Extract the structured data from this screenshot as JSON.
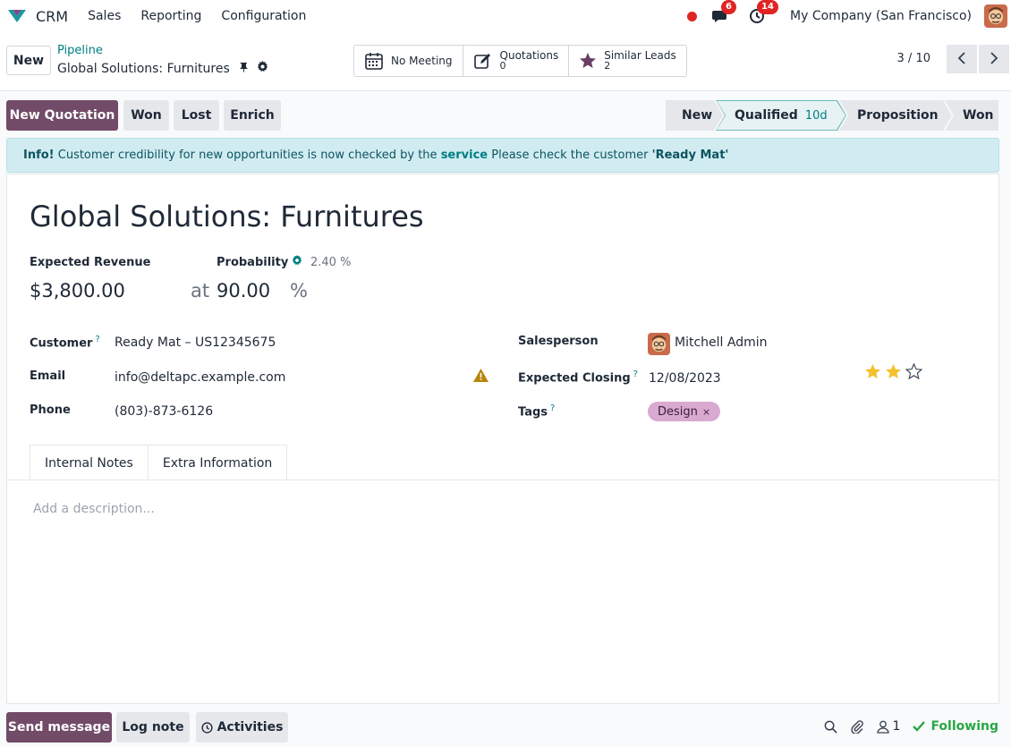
{
  "topbar": {
    "app_name": "CRM",
    "menu": [
      "Sales",
      "Reporting",
      "Configuration"
    ],
    "messages_count": "6",
    "activities_count": "14",
    "company": "My Company (San Francisco)",
    "brand_color": "#714b67",
    "badge_color": "#e02424",
    "rec_color": "#e02424"
  },
  "control": {
    "new_label": "New",
    "breadcrumb": "Pipeline",
    "record_title": "Global Solutions: Furnitures",
    "smart_buttons": [
      {
        "label": "No Meeting",
        "value": "",
        "icon": "calendar-icon"
      },
      {
        "label": "Quotations",
        "value": "0",
        "icon": "pen-square-icon"
      },
      {
        "label": "Similar Leads",
        "value": "2",
        "icon": "star-icon"
      }
    ],
    "pager": "3 / 10",
    "prev": "‹",
    "next": "›"
  },
  "actions": {
    "new_quotation": "New Quotation",
    "won": "Won",
    "lost": "Lost",
    "enrich": "Enrich"
  },
  "stages": [
    {
      "label": "New",
      "duration": ""
    },
    {
      "label": "Qualified",
      "duration": "10d"
    },
    {
      "label": "Proposition",
      "duration": ""
    },
    {
      "label": "Won",
      "duration": ""
    }
  ],
  "alert": {
    "prefix": "Info!",
    "text1": "Customer credibility for new opportunities is now checked by the",
    "link": "service",
    "text2": "Please check the customer",
    "customer": "'Ready Mat'"
  },
  "form": {
    "name": "Global Solutions: Furnitures",
    "expected_revenue_label": "Expected Revenue",
    "expected_revenue": "$3,800.00",
    "at": "at",
    "probability_label": "Probability",
    "probability_auto": "2.40 %",
    "probability": "90.00",
    "percent": "%",
    "customer_label": "Customer",
    "customer": "Ready Mat – US12345675",
    "email_label": "Email",
    "email": "info@deltapc.example.com",
    "phone_label": "Phone",
    "phone": "(803)-873-6126",
    "salesperson_label": "Salesperson",
    "salesperson": "Mitchell Admin",
    "closing_label": "Expected Closing",
    "closing": "12/08/2023",
    "tags_label": "Tags",
    "tag": "Design",
    "tag_remove": "×",
    "help": "?",
    "priority_stars": 2,
    "priority_max": 3
  },
  "tabs": [
    "Internal Notes",
    "Extra Information"
  ],
  "description_placeholder": "Add a description...",
  "chatter": {
    "send": "Send message",
    "log": "Log note",
    "activities": "Activities",
    "followers_count": "1",
    "following": "Following"
  }
}
